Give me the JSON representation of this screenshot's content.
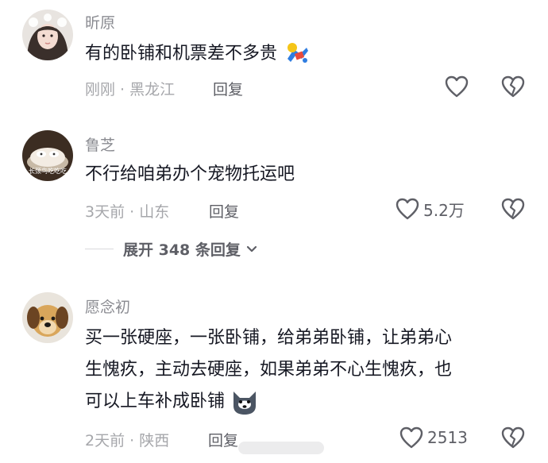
{
  "comments": [
    {
      "username": "昕原",
      "text_lines": [
        "有的卧铺和机票差不多贵"
      ],
      "time": "刚刚",
      "location": "黑龙江",
      "reply_label": "回复",
      "like_count": "",
      "emoji": "doll-emoji"
    },
    {
      "username": "鲁芝",
      "avatar_caption": "长颈鸟吃吃吃",
      "text_lines": [
        "不行给咱弟办个宠物托运吧"
      ],
      "time": "3天前",
      "location": "山东",
      "reply_label": "回复",
      "like_count": "5.2万",
      "expand_label": "展开 348 条回复"
    },
    {
      "username": "愿念初",
      "text_lines": [
        "买一张硬座，一张卧铺，给弟弟卧铺，让弟弟心",
        "生愧疚，主动去硬座，如果弟弟不心生愧疚，也",
        "可以上车补成卧铺"
      ],
      "time": "2天前",
      "location": "陕西",
      "reply_label": "回复",
      "like_count": "2513",
      "emoji": "husky-emoji"
    }
  ],
  "separator": " · ",
  "colors": {
    "text": "#161823",
    "secondary": "#8a8b91",
    "meta": "#a6a7ab",
    "action": "#5e5f66"
  }
}
